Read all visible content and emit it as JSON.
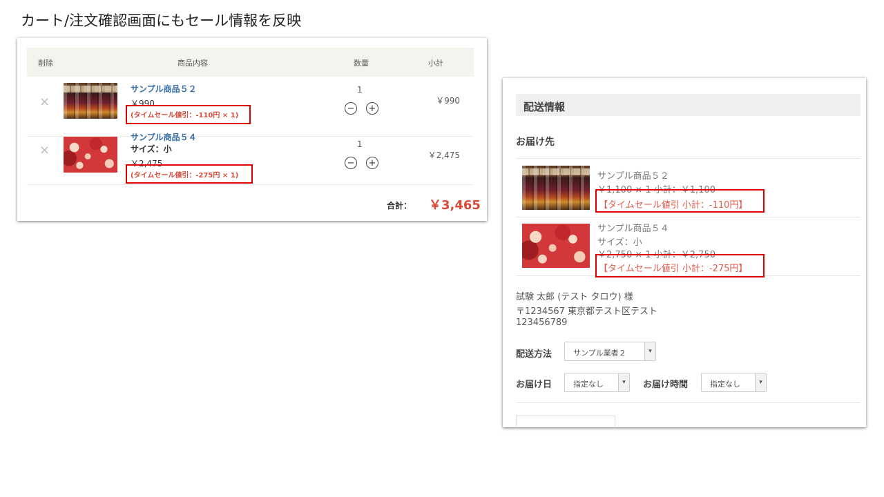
{
  "slide_title": "カート/注文確認画面にもセール情報を反映",
  "cart": {
    "headers": {
      "delete": "削除",
      "content": "商品内容",
      "qty": "数量",
      "subtotal": "小計"
    },
    "items": [
      {
        "delete_icon": "×",
        "name": "サンプル商品５２",
        "attr": "",
        "price": "￥990",
        "sale": "(タイムセール値引：-110円 × 1)",
        "qty": "1",
        "subtotal": "￥990"
      },
      {
        "delete_icon": "×",
        "name": "サンプル商品５４",
        "attr": "サイズ：小",
        "price": "￥2,475",
        "sale": "(タイムセール値引：-275円 × 1)",
        "qty": "1",
        "subtotal": "￥2,475"
      }
    ],
    "minus_icon": "−",
    "plus_icon": "+",
    "total_label": "合計：",
    "total_value": "￥3,465"
  },
  "shipping": {
    "title": "配送情報",
    "destination_label": "お届け先",
    "items": [
      {
        "name": "サンプル商品５２",
        "attr": "",
        "price_line": "￥1,100 × 1  小計：￥1,100",
        "sale": "【タイムセール値引 小計：-110円】"
      },
      {
        "name": "サンプル商品５４",
        "attr": "サイズ：小",
        "price_line": "￥2,750 × 1  小計：￥2,750",
        "sale": "【タイムセール値引 小計：-275円】"
      }
    ],
    "address": {
      "name": "試験 太郎 (テスト タロウ) 様",
      "postal": "〒1234567 東京都テスト区テスト",
      "phone": "123456789"
    },
    "method_label": "配送方法",
    "method_value": "サンプル業者２",
    "date_label": "お届け日",
    "date_value": "指定なし",
    "time_label": "お届け時間",
    "time_value": "指定なし",
    "arrow_icon": "▾"
  },
  "colors": {
    "highlight": "#e00000",
    "sale_text": "#d94a3a",
    "link": "#3a6ea5"
  }
}
